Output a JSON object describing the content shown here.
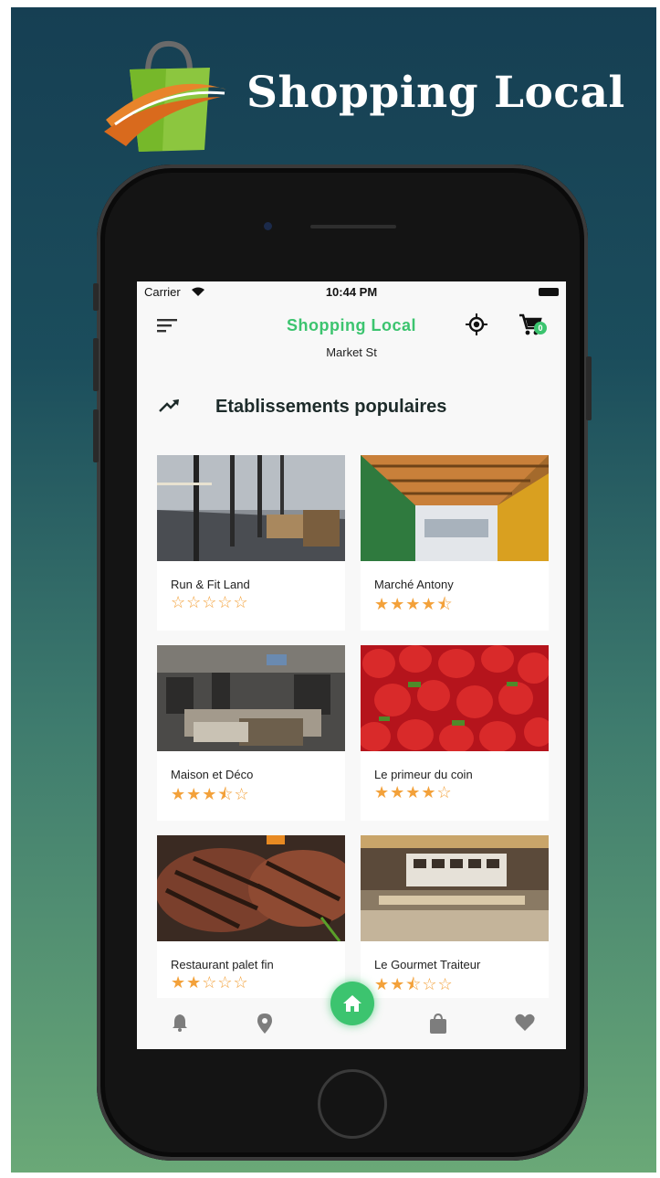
{
  "brand": {
    "name": "Shopping Local"
  },
  "status_bar": {
    "carrier": "Carrier",
    "time": "10:44 PM"
  },
  "header": {
    "title": "Shopping Local",
    "location": "Market St",
    "cart_count": "0"
  },
  "section": {
    "title": "Etablissements populaires",
    "icon": "trending-up-icon"
  },
  "stores": [
    {
      "name": "Run & Fit Land",
      "rating": "☆☆☆☆☆"
    },
    {
      "name": "Marché Antony",
      "rating": "★★★★⯪"
    },
    {
      "name": "Maison et Déco",
      "rating": "★★★⯪☆"
    },
    {
      "name": "Le primeur du coin",
      "rating": "★★★★☆"
    },
    {
      "name": "Restaurant palet fin",
      "rating": "★★☆☆☆"
    },
    {
      "name": "Le Gourmet Traiteur",
      "rating": "★★⯪☆☆"
    }
  ],
  "bottom_nav": {
    "items": [
      "bell-icon",
      "location-pin-icon",
      "home-icon",
      "shopping-bag-icon",
      "heart-icon"
    ],
    "active": "home-icon"
  },
  "colors": {
    "accent": "#3cc46f",
    "star": "#f3a13a",
    "poster_top": "#163f53",
    "poster_bottom": "#6aa877"
  }
}
